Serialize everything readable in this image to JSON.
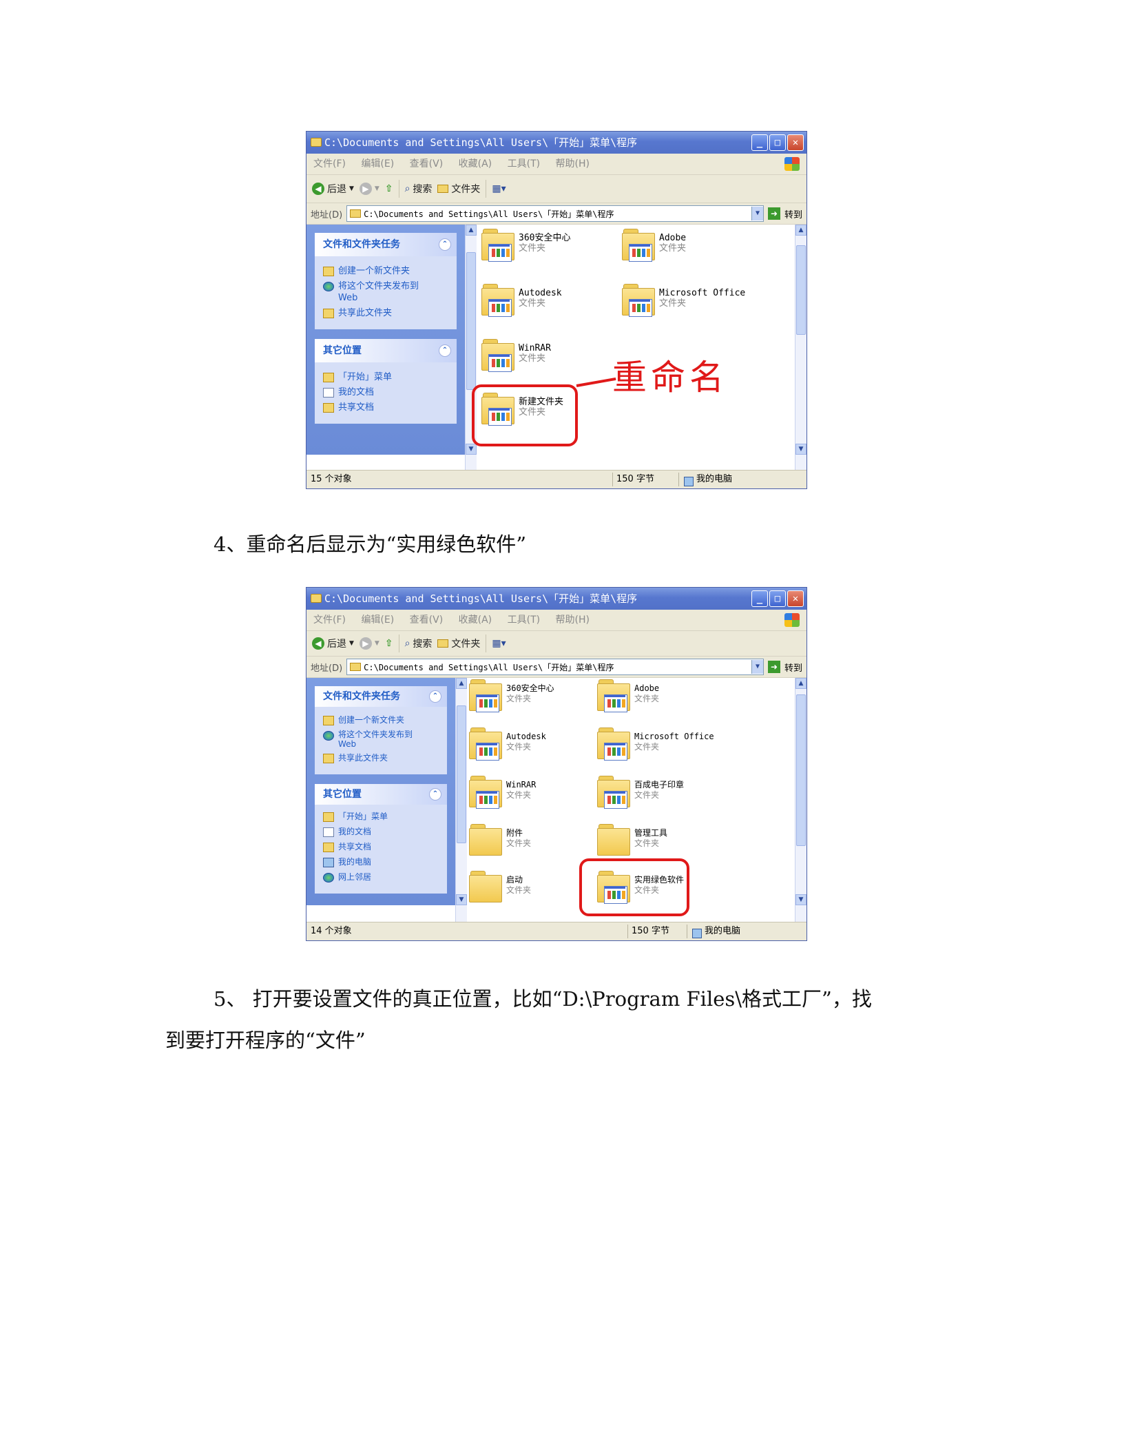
{
  "window1": {
    "title": "C:\\Documents and Settings\\All Users\\「开始」菜单\\程序",
    "menu": [
      "文件(F)",
      "编辑(E)",
      "查看(V)",
      "收藏(A)",
      "工具(T)",
      "帮助(H)"
    ],
    "toolbar": {
      "back": "后退",
      "search": "搜索",
      "folders": "文件夹"
    },
    "address_label": "地址(D)",
    "address_value": "C:\\Documents and Settings\\All Users\\「开始」菜单\\程序",
    "go": "转到",
    "tasks_title": "文件和文件夹任务",
    "tasks": [
      "创建一个新文件夹",
      "将这个文件夹发布到\nWeb",
      "共享此文件夹"
    ],
    "other_title": "其它位置",
    "other": [
      "「开始」菜单",
      "我的文档",
      "共享文档"
    ],
    "files": [
      {
        "name": "360安全中心",
        "type": "文件夹"
      },
      {
        "name": "Adobe",
        "type": "文件夹"
      },
      {
        "name": "Autodesk",
        "type": "文件夹"
      },
      {
        "name": "Microsoft Office",
        "type": "文件夹"
      },
      {
        "name": "WinRAR",
        "type": "文件夹"
      },
      {
        "name": "新建文件夹",
        "type": "文件夹"
      }
    ],
    "status": {
      "objects": "15 个对象",
      "size": "150 字节",
      "location": "我的电脑"
    },
    "annotation": "重命名",
    "annotation_color": "#e01919"
  },
  "step4": "4、重命名后显示为“实用绿色软件”",
  "window2": {
    "title": "C:\\Documents and Settings\\All Users\\「开始」菜单\\程序",
    "menu": [
      "文件(F)",
      "编辑(E)",
      "查看(V)",
      "收藏(A)",
      "工具(T)",
      "帮助(H)"
    ],
    "toolbar": {
      "back": "后退",
      "search": "搜索",
      "folders": "文件夹"
    },
    "address_label": "地址(D)",
    "address_value": "C:\\Documents and Settings\\All Users\\「开始」菜单\\程序",
    "go": "转到",
    "tasks_title": "文件和文件夹任务",
    "tasks": [
      "创建一个新文件夹",
      "将这个文件夹发布到\nWeb",
      "共享此文件夹"
    ],
    "other_title": "其它位置",
    "other": [
      "「开始」菜单",
      "我的文档",
      "共享文档",
      "我的电脑",
      "网上邻居"
    ],
    "files": [
      {
        "name": "360安全中心",
        "type": "文件夹"
      },
      {
        "name": "Adobe",
        "type": "文件夹"
      },
      {
        "name": "Autodesk",
        "type": "文件夹"
      },
      {
        "name": "Microsoft Office",
        "type": "文件夹"
      },
      {
        "name": "WinRAR",
        "type": "文件夹"
      },
      {
        "name": "百成电子印章",
        "type": "文件夹"
      },
      {
        "name": "附件",
        "type": "文件夹"
      },
      {
        "name": "管理工具",
        "type": "文件夹"
      },
      {
        "name": "启动",
        "type": "文件夹"
      },
      {
        "name": "实用绿色软件",
        "type": "文件夹"
      }
    ],
    "status": {
      "objects": "14 个对象",
      "size": "150 字节",
      "location": "我的电脑"
    }
  },
  "step5_line1": "5、  打开要设置文件的真正位置，比如“D:\\Program Files\\格式工厂”，找",
  "step5_line2": "到要打开程序的“文件”"
}
